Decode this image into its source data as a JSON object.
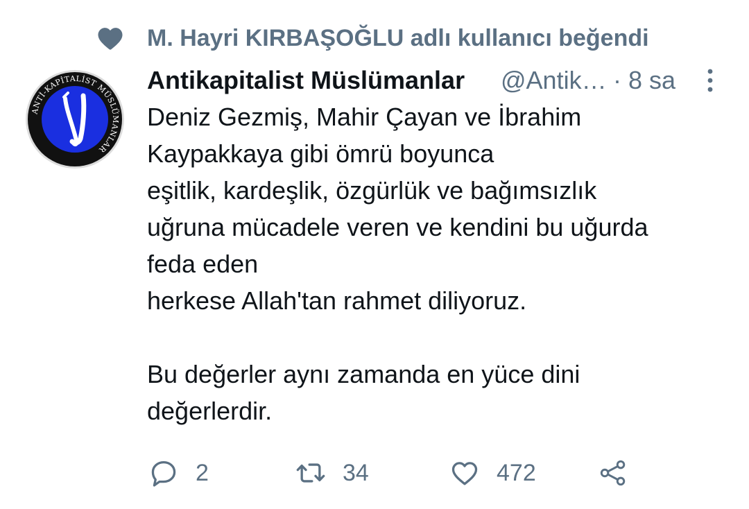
{
  "social_context": {
    "icon": "heart-icon",
    "text": "M. Hayri KIRBAŞOĞLU adlı kullanıcı beğendi"
  },
  "tweet": {
    "author_name": "Antikapitalist Müslümanlar",
    "author_handle": "@Antikapitalist…",
    "separator": "·",
    "time": "8 sa",
    "avatar": {
      "icon": "avatar-logo",
      "ring_text": "ANTİ-KAPİTALİST MÜSLÜMANLAR"
    },
    "body_lines": [
      "Deniz Gezmiş, Mahir Çayan ve İbrahim",
      "Kaypakkaya gibi ömrü boyunca",
      "eşitlik, kardeşlik, özgürlük ve bağımsızlık",
      "uğruna mücadele veren ve kendini bu uğurda",
      "feda eden",
      "herkese Allah'tan rahmet diliyoruz."
    ],
    "body_lines_2": [
      "Bu değerler aynı zamanda en yüce dini",
      "değerlerdir."
    ]
  },
  "actions": {
    "reply_count": "2",
    "retweet_count": "34",
    "like_count": "472",
    "icons": [
      "reply-icon",
      "retweet-icon",
      "like-icon",
      "share-icon"
    ]
  },
  "colors": {
    "secondary_text": "#5b7083",
    "primary_text": "#0f1419",
    "avatar_blue": "#1a2fe0"
  }
}
